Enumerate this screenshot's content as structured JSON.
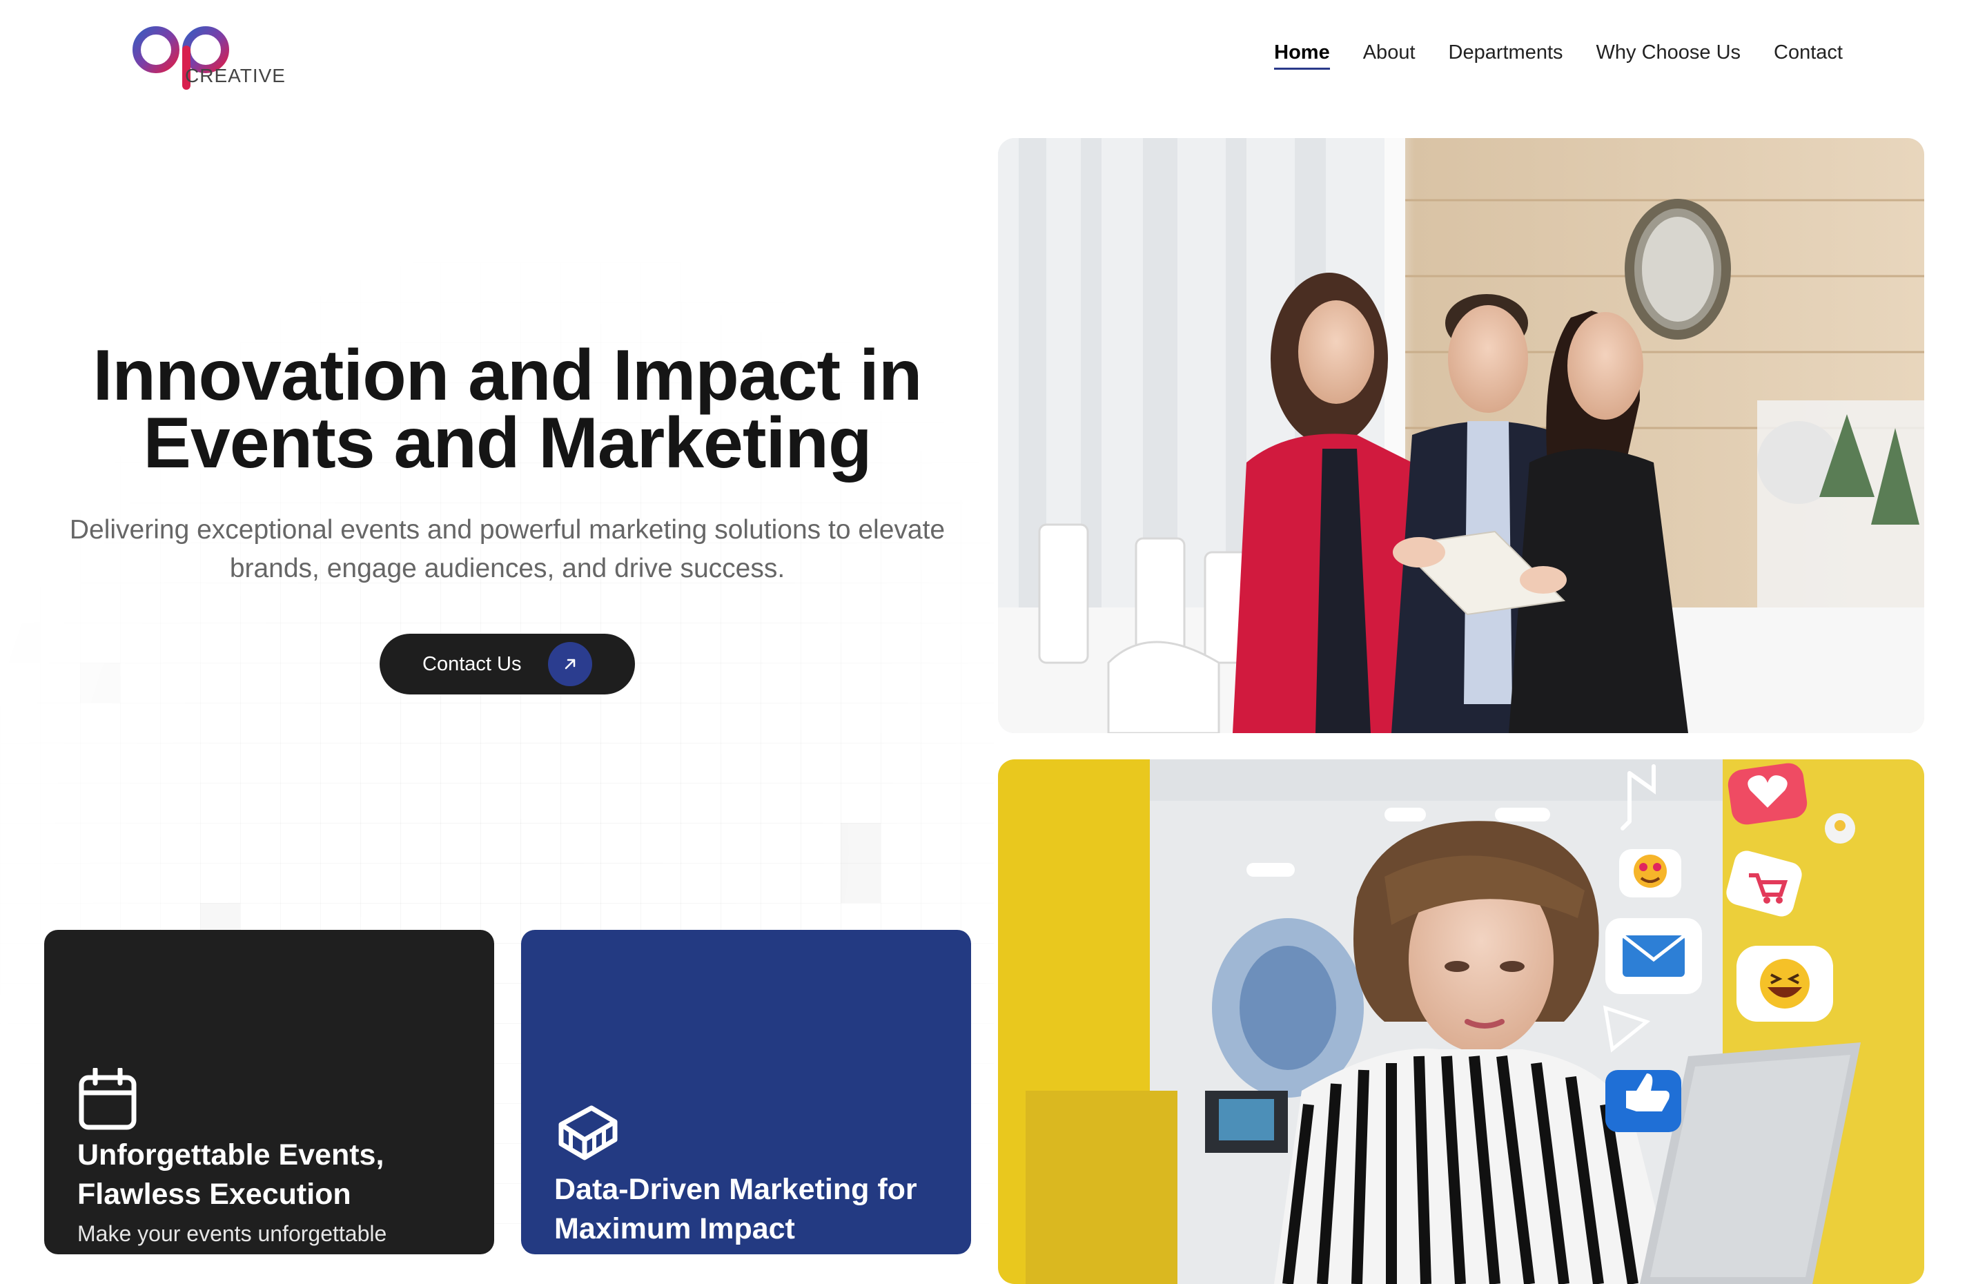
{
  "brand": {
    "logo_letters": "ap",
    "logo_sub": "CREATIVE"
  },
  "nav": {
    "items": [
      {
        "label": "Home",
        "active": true
      },
      {
        "label": "About"
      },
      {
        "label": "Departments"
      },
      {
        "label": "Why Choose Us"
      },
      {
        "label": "Contact"
      }
    ]
  },
  "hero": {
    "title_line1": "Innovation and Impact in",
    "title_line2": "Events and Marketing",
    "subtitle_line1": "Delivering exceptional events and powerful marketing solutions to elevate",
    "subtitle_line2": "brands, engage audiences, and drive success.",
    "cta_label": "Contact Us",
    "cta_icon": "arrow-up-right-icon"
  },
  "cards": [
    {
      "icon": "calendar-icon",
      "title_line1": "Unforgettable Events,",
      "title_line2": "Flawless Execution",
      "text": "Make your events unforgettable"
    },
    {
      "icon": "cube-icon",
      "title_line1": "Data-Driven Marketing for",
      "title_line2": "Maximum Impact"
    }
  ],
  "colors": {
    "accent_blue": "#233a82",
    "dark": "#1f1f1f",
    "photo_yellow": "#e9c81e",
    "blazer_red": "#d11a3e"
  }
}
